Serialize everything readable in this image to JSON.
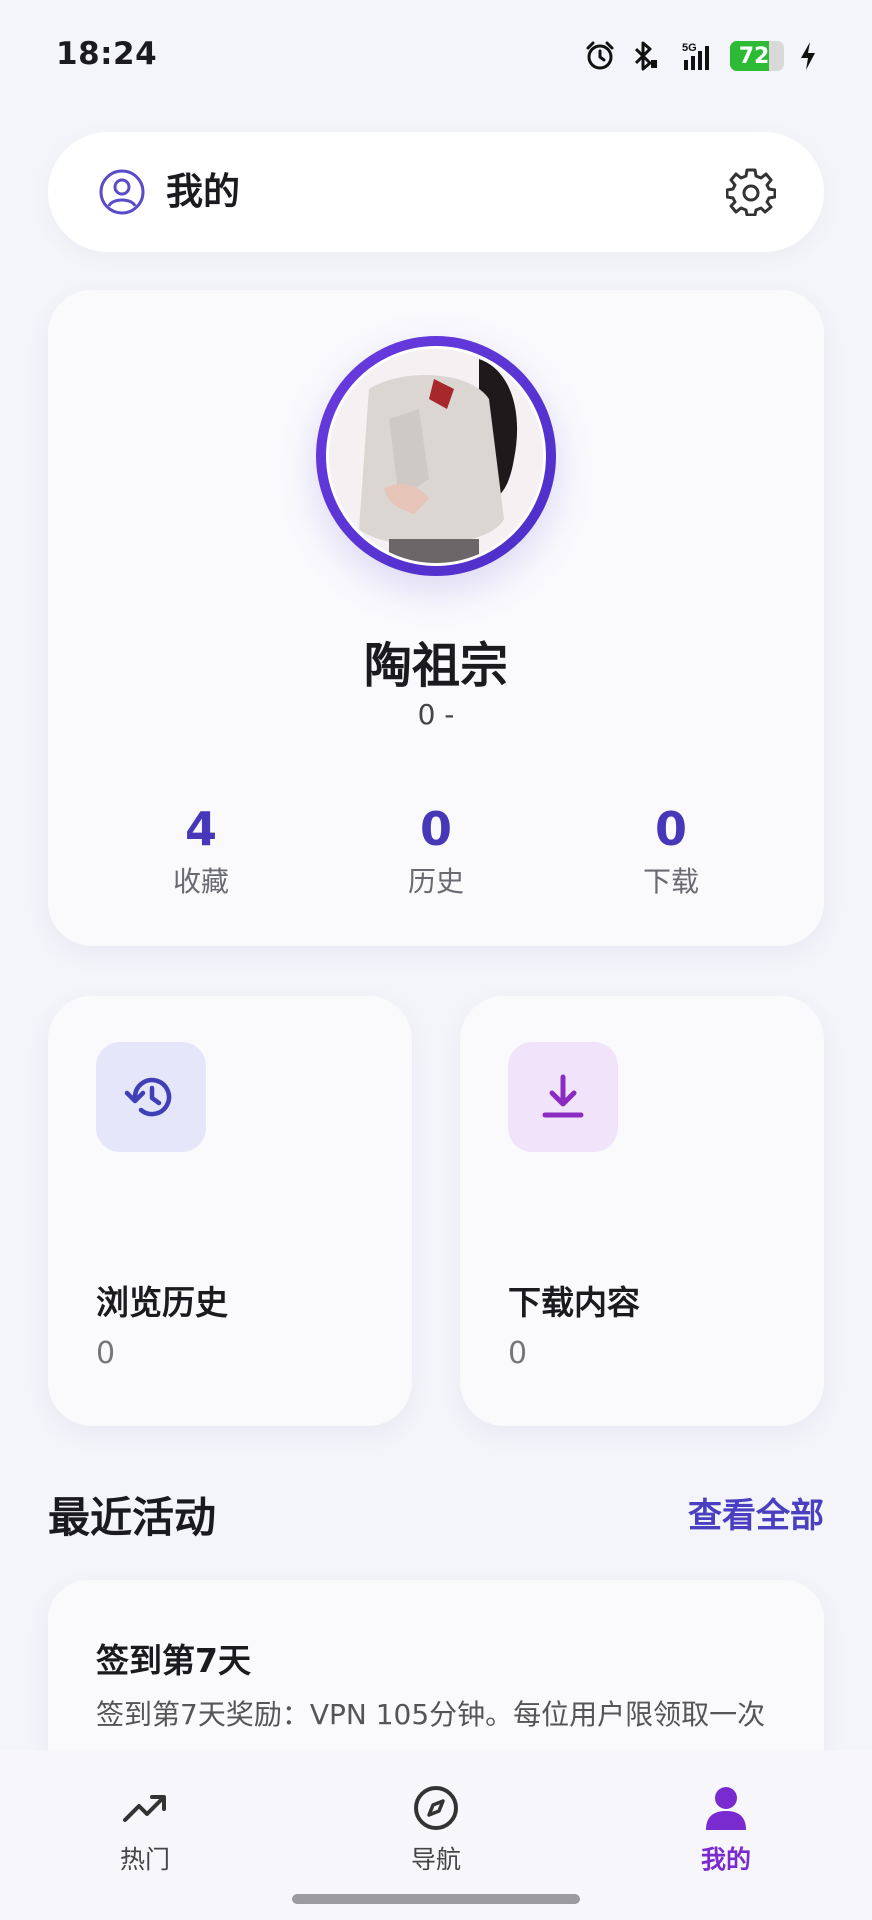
{
  "status_bar": {
    "time": "18:24",
    "battery_level": "72",
    "battery_fraction": 0.72,
    "network": "5G",
    "icons": [
      "alarm-icon",
      "bluetooth-icon",
      "signal-icon",
      "battery-icon",
      "charging-icon"
    ]
  },
  "header": {
    "title": "我的",
    "user_icon": "user-circle-icon",
    "settings_icon": "gear-icon"
  },
  "profile": {
    "name": "陶祖宗",
    "subtitle": "0 -",
    "stats": [
      {
        "value": "4",
        "label": "收藏"
      },
      {
        "value": "0",
        "label": "历史"
      },
      {
        "value": "0",
        "label": "下载"
      }
    ]
  },
  "features": [
    {
      "title": "浏览历史",
      "value": "0",
      "icon": "history-icon"
    },
    {
      "title": "下载内容",
      "value": "0",
      "icon": "download-icon"
    }
  ],
  "recent": {
    "title": "最近活动",
    "view_all": "查看全部",
    "items": [
      {
        "title": "签到第7天",
        "desc": "签到第7天奖励：VPN 105分钟。每位用户限领取一次"
      }
    ]
  },
  "nav": {
    "items": [
      {
        "label": "热门",
        "icon": "trending-icon"
      },
      {
        "label": "导航",
        "icon": "compass-icon"
      },
      {
        "label": "我的",
        "icon": "person-icon"
      }
    ],
    "active": "我的"
  },
  "colors": {
    "accent": "#4a3fc0",
    "active_nav": "#7a2bd0",
    "background": "#f4f5fa",
    "battery": "#2dbb36"
  }
}
